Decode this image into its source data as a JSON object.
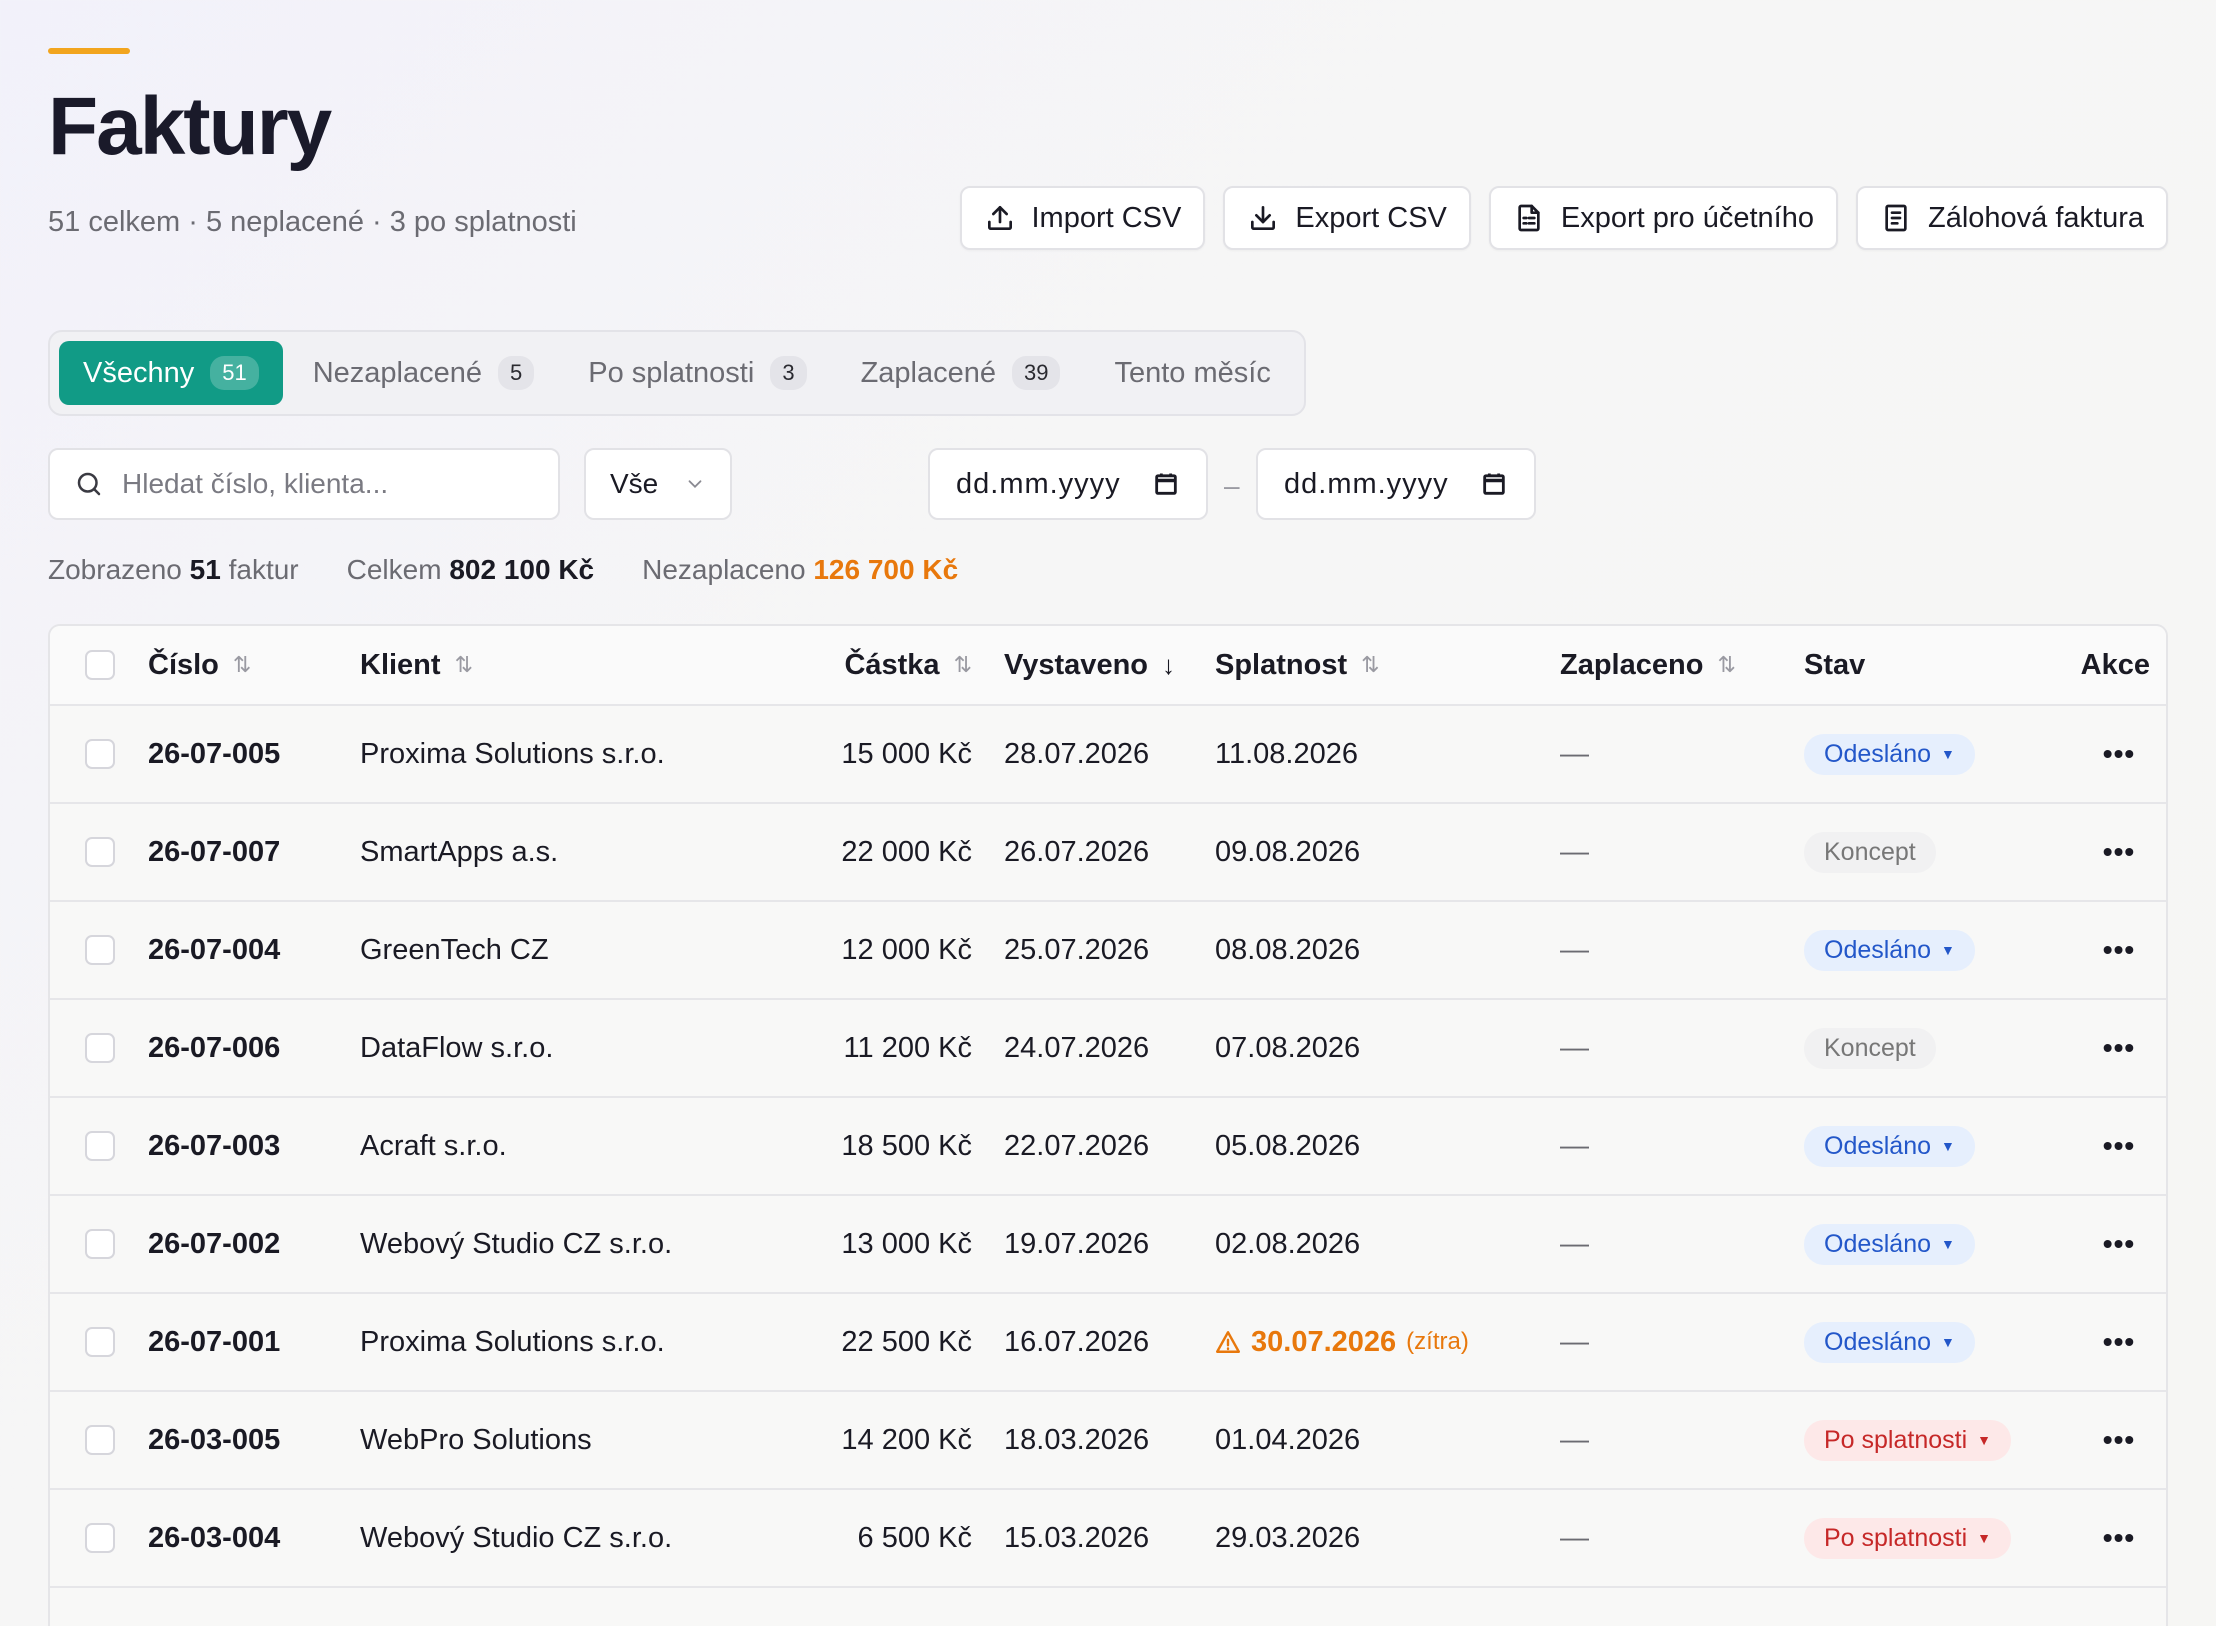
{
  "header": {
    "title": "Faktury",
    "subtitle": "51 celkem · 5 neplacené · 3 po splatnosti"
  },
  "actions": {
    "import_csv": "Import CSV",
    "export_csv": "Export CSV",
    "export_accountant": "Export pro účetního",
    "advance_invoice": "Zálohová faktura"
  },
  "tabs": [
    {
      "label": "Všechny",
      "count": "51",
      "active": true
    },
    {
      "label": "Nezaplacené",
      "count": "5"
    },
    {
      "label": "Po splatnosti",
      "count": "3"
    },
    {
      "label": "Zaplacené",
      "count": "39"
    },
    {
      "label": "Tento měsíc",
      "count": ""
    }
  ],
  "filters": {
    "search_placeholder": "Hledat číslo, klienta...",
    "status_value": "Vše",
    "date_from": "dd.mm.yyyy",
    "date_sep": "–",
    "date_to": "dd.mm.yyyy"
  },
  "summary": {
    "shown_label": "Zobrazeno",
    "shown_count": "51",
    "shown_unit": "faktur",
    "total_label": "Celkem",
    "total_value": "802 100 Kč",
    "unpaid_label": "Nezaplaceno",
    "unpaid_value": "126 700 Kč"
  },
  "columns": {
    "number": "Číslo",
    "client": "Klient",
    "amount": "Částka",
    "issued": "Vystaveno",
    "due": "Splatnost",
    "paid": "Zaplaceno",
    "status": "Stav",
    "actions": "Akce"
  },
  "rows": [
    {
      "number": "26-07-005",
      "client": "Proxima Solutions s.r.o.",
      "amount": "15 000 Kč",
      "issued": "28.07.2026",
      "due": "11.08.2026",
      "paid": "—",
      "status": "Odesláno",
      "status_type": "sent"
    },
    {
      "number": "26-07-007",
      "client": "SmartApps a.s.",
      "amount": "22 000 Kč",
      "issued": "26.07.2026",
      "due": "09.08.2026",
      "paid": "—",
      "status": "Koncept",
      "status_type": "draft"
    },
    {
      "number": "26-07-004",
      "client": "GreenTech CZ",
      "amount": "12 000 Kč",
      "issued": "25.07.2026",
      "due": "08.08.2026",
      "paid": "—",
      "status": "Odesláno",
      "status_type": "sent"
    },
    {
      "number": "26-07-006",
      "client": "DataFlow s.r.o.",
      "amount": "11 200 Kč",
      "issued": "24.07.2026",
      "due": "07.08.2026",
      "paid": "—",
      "status": "Koncept",
      "status_type": "draft"
    },
    {
      "number": "26-07-003",
      "client": "Acraft s.r.o.",
      "amount": "18 500 Kč",
      "issued": "22.07.2026",
      "due": "05.08.2026",
      "paid": "—",
      "status": "Odesláno",
      "status_type": "sent"
    },
    {
      "number": "26-07-002",
      "client": "Webový Studio CZ s.r.o.",
      "amount": "13 000 Kč",
      "issued": "19.07.2026",
      "due": "02.08.2026",
      "paid": "—",
      "status": "Odesláno",
      "status_type": "sent"
    },
    {
      "number": "26-07-001",
      "client": "Proxima Solutions s.r.o.",
      "amount": "22 500 Kč",
      "issued": "16.07.2026",
      "due": "30.07.2026",
      "due_hint": "(zítra)",
      "due_warning": true,
      "paid": "—",
      "status": "Odesláno",
      "status_type": "sent"
    },
    {
      "number": "26-03-005",
      "client": "WebPro Solutions",
      "amount": "14 200 Kč",
      "issued": "18.03.2026",
      "due": "01.04.2026",
      "paid": "—",
      "status": "Po splatnosti",
      "status_type": "overdue"
    },
    {
      "number": "26-03-004",
      "client": "Webový Studio CZ s.r.o.",
      "amount": "6 500 Kč",
      "issued": "15.03.2026",
      "due": "29.03.2026",
      "paid": "—",
      "status": "Po splatnosti",
      "status_type": "overdue"
    }
  ],
  "colors": {
    "accent_teal": "#119b86",
    "accent_orange": "#e8780c",
    "status_sent": "#2357c9",
    "status_overdue": "#c62828"
  }
}
